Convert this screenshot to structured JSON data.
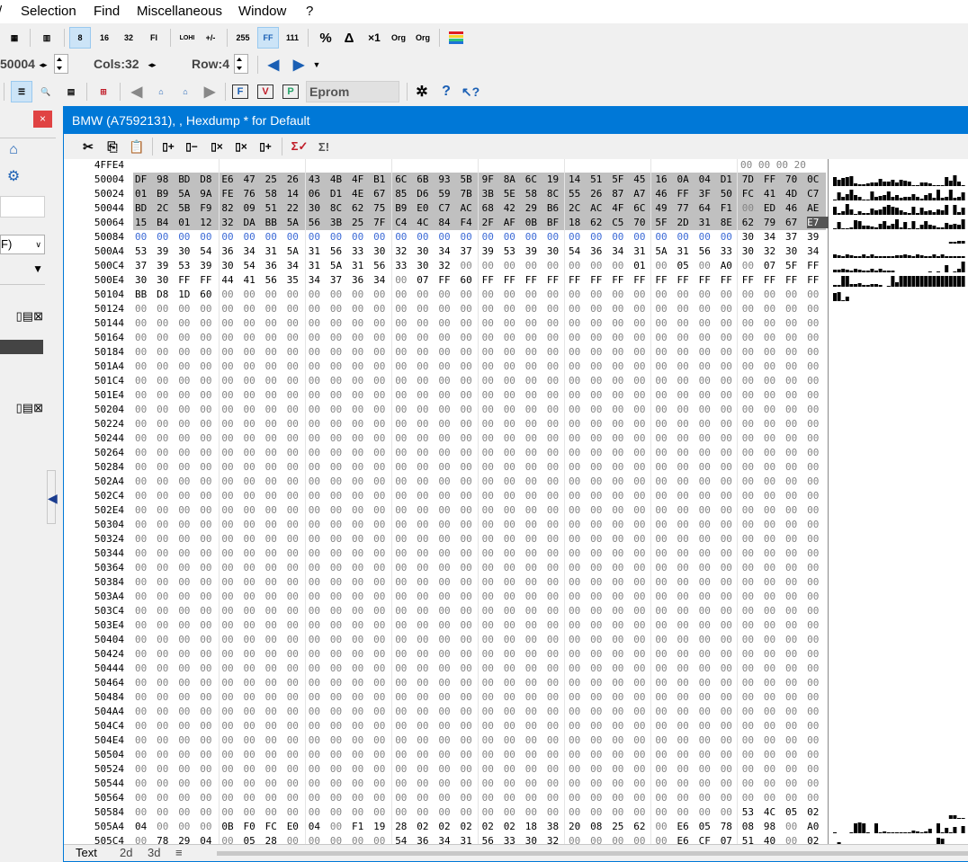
{
  "menu": [
    "Selection",
    "Find",
    "Miscellaneous",
    "Window",
    "?"
  ],
  "toolbar2": {
    "address": "50004",
    "cols_label": "Cols:32",
    "row_label": "Row:4"
  },
  "toolbar3": {
    "eprom_label": "Eprom"
  },
  "child": {
    "title": "BMW (A7592131), , Hexdump * for Default",
    "tabs": [
      "Text",
      "2d",
      "3d"
    ]
  },
  "hex": {
    "header_address": "4FFE4",
    "header_bytes": "00 00 00 20",
    "rows": [
      {
        "addr": "50004",
        "bytes": "DF 98 BD D8 E6 47 25 26 43 4B 4F B1 6C 6B 93 5B 9F 8A 6C 19 14 51 5F 45 16 0A 04 D1 7D FF 70 0C"
      },
      {
        "addr": "50024",
        "bytes": "01 B9 5A 9A FE 76 58 14 06 D1 4E 67 85 D6 59 7B 3B 5E 58 8C 55 26 87 A7 46 FF 3F 50 FC 41 4D C7"
      },
      {
        "addr": "50044",
        "bytes": "BD 2C 5B F9 82 09 51 22 30 8C 62 75 B9 E0 C7 AC 68 42 29 B6 2C AC 4F 6C 49 77 64 F1 00 ED 46 AE"
      },
      {
        "addr": "50064",
        "bytes": "15 B4 01 12 32 DA BB 5A 56 3B 25 7F C4 4C 84 F4 2F AF 0B BF 18 62 C5 70 5F 2D 31 8E 62 79 67 E7"
      },
      {
        "addr": "50084",
        "bytes": "00 00 00 00 00 00 00 00 00 00 00 00 00 00 00 00 00 00 00 00 00 00 00 00 00 00 00 00 30 34 37 39"
      },
      {
        "addr": "500A4",
        "bytes": "53 39 30 54 36 34 31 5A 31 56 33 30 32 30 34 37 39 53 39 30 54 36 34 31 5A 31 56 33 30 32 30 34"
      },
      {
        "addr": "500C4",
        "bytes": "37 39 53 39 30 54 36 34 31 5A 31 56 33 30 32 00 00 00 00 00 00 00 00 01 00 05 00 A0 00 07 5F FF"
      },
      {
        "addr": "500E4",
        "bytes": "30 30 FF FF 44 41 56 35 34 37 36 34 00 07 FF 60 FF FF FF FF FF FF FF FF FF FF FF FF FF FF FF FF"
      },
      {
        "addr": "50104",
        "bytes": "BB D8 1D 60 00 00 00 00 00 00 00 00 00 00 00 00 00 00 00 00 00 00 00 00 00 00 00 00 00 00 00 00"
      },
      {
        "addr": "50124",
        "bytes": ""
      },
      {
        "addr": "50144",
        "bytes": ""
      },
      {
        "addr": "50164",
        "bytes": ""
      },
      {
        "addr": "50184",
        "bytes": ""
      },
      {
        "addr": "501A4",
        "bytes": ""
      },
      {
        "addr": "501C4",
        "bytes": ""
      },
      {
        "addr": "501E4",
        "bytes": ""
      },
      {
        "addr": "50204",
        "bytes": ""
      },
      {
        "addr": "50224",
        "bytes": ""
      },
      {
        "addr": "50244",
        "bytes": ""
      },
      {
        "addr": "50264",
        "bytes": ""
      },
      {
        "addr": "50284",
        "bytes": ""
      },
      {
        "addr": "502A4",
        "bytes": ""
      },
      {
        "addr": "502C4",
        "bytes": ""
      },
      {
        "addr": "502E4",
        "bytes": ""
      },
      {
        "addr": "50304",
        "bytes": ""
      },
      {
        "addr": "50324",
        "bytes": ""
      },
      {
        "addr": "50344",
        "bytes": ""
      },
      {
        "addr": "50364",
        "bytes": ""
      },
      {
        "addr": "50384",
        "bytes": ""
      },
      {
        "addr": "503A4",
        "bytes": ""
      },
      {
        "addr": "503C4",
        "bytes": ""
      },
      {
        "addr": "503E4",
        "bytes": ""
      },
      {
        "addr": "50404",
        "bytes": ""
      },
      {
        "addr": "50424",
        "bytes": ""
      },
      {
        "addr": "50444",
        "bytes": ""
      },
      {
        "addr": "50464",
        "bytes": ""
      },
      {
        "addr": "50484",
        "bytes": ""
      },
      {
        "addr": "504A4",
        "bytes": ""
      },
      {
        "addr": "504C4",
        "bytes": ""
      },
      {
        "addr": "504E4",
        "bytes": ""
      },
      {
        "addr": "50504",
        "bytes": ""
      },
      {
        "addr": "50524",
        "bytes": ""
      },
      {
        "addr": "50544",
        "bytes": ""
      },
      {
        "addr": "50564",
        "bytes": ""
      },
      {
        "addr": "50584",
        "bytes": "00 00 00 00 00 00 00 00 00 00 00 00 00 00 00 00 00 00 00 00 00 00 00 00 00 00 00 00 53 4C 05 02"
      },
      {
        "addr": "505A4",
        "bytes": "04 00 00 00 0B F0 FC E0 04 00 F1 19 28 02 02 02 02 02 18 38 20 08 25 62 00 E6 05 78 08 98 00 A0"
      },
      {
        "addr": "505C4",
        "bytes": "00 78 29 04 00 05 28 00 00 00 00 00 54 36 34 31 56 33 30 32 00 00 00 00 00 E6 CF 07 51 40 00 02"
      }
    ]
  },
  "colors": {
    "title_bar": "#0078d7",
    "selection": "#c0c0c0",
    "zero_byte": "#848484"
  }
}
